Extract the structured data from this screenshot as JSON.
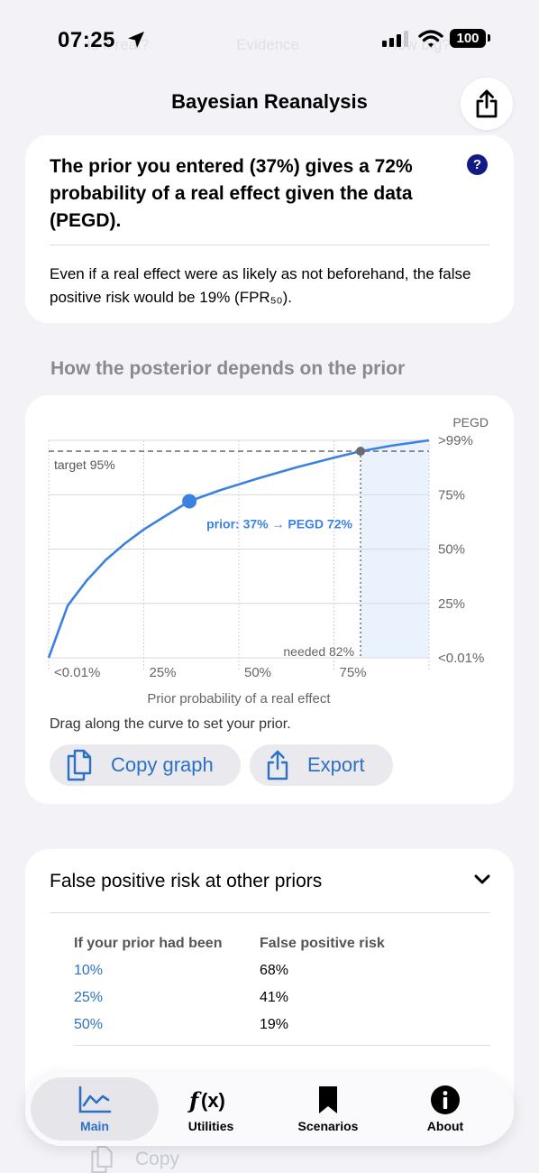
{
  "status": {
    "time": "07:25",
    "battery": "100"
  },
  "ghost_segments": [
    "Is it real?",
    "Evidence",
    "How big?"
  ],
  "nav": {
    "title": "Bayesian Reanalysis"
  },
  "summary": {
    "headline": "The prior you entered (37%) gives a 72% probability of a real effect given the data (PEGD).",
    "help": "?",
    "body": "Even if a real effect were as likely as not beforehand, the false positive risk would be 19% (FPR₅₀)."
  },
  "section_title": "How the posterior depends on the prior",
  "chart_data": {
    "type": "line",
    "ylabel": "PEGD",
    "xlabel": "Prior probability of a real effect",
    "x_ticks": [
      "<0.01%",
      "25%",
      "50%",
      "75%"
    ],
    "y_ticks": [
      ">99%",
      "75%",
      "50%",
      "25%",
      "<0.01%"
    ],
    "xlim": [
      0,
      100
    ],
    "ylim": [
      0,
      100
    ],
    "series": [
      {
        "values": [
          [
            0,
            0
          ],
          [
            5,
            24
          ],
          [
            10,
            35.5
          ],
          [
            15,
            45
          ],
          [
            20,
            52.5
          ],
          [
            25,
            59
          ],
          [
            30,
            64.5
          ],
          [
            37,
            72
          ],
          [
            45,
            77
          ],
          [
            55,
            82.5
          ],
          [
            65,
            87.5
          ],
          [
            75,
            92
          ],
          [
            82,
            95
          ],
          [
            90,
            97.5
          ],
          [
            100,
            100
          ]
        ]
      }
    ],
    "target": {
      "y": 95,
      "label": "target 95%"
    },
    "needed": {
      "x": 82,
      "label": "needed 82%"
    },
    "selected": {
      "x": 37,
      "y": 72,
      "label": "prior: 37% → PEGD 72%"
    },
    "colors": {
      "curve": "#3b82e0",
      "shade": "#eaf2fd",
      "target_line": "#777777"
    }
  },
  "drag_hint": "Drag along the curve to set your prior.",
  "buttons": {
    "copy_graph": "Copy graph",
    "export": "Export"
  },
  "fpr": {
    "title": "False positive risk at other priors",
    "col1": "If your prior had been",
    "col2": "False positive risk",
    "rows": [
      {
        "prior": "10%",
        "fpr": "68%"
      },
      {
        "prior": "25%",
        "fpr": "41%"
      },
      {
        "prior": "50%",
        "fpr": "19%"
      }
    ]
  },
  "behind": {
    "copy": "Copy"
  },
  "tabs": [
    {
      "label": "Main",
      "icon": "chart-icon"
    },
    {
      "label": "Utilities",
      "icon": "function-icon"
    },
    {
      "label": "Scenarios",
      "icon": "bookmark-icon"
    },
    {
      "label": "About",
      "icon": "info-icon"
    }
  ]
}
